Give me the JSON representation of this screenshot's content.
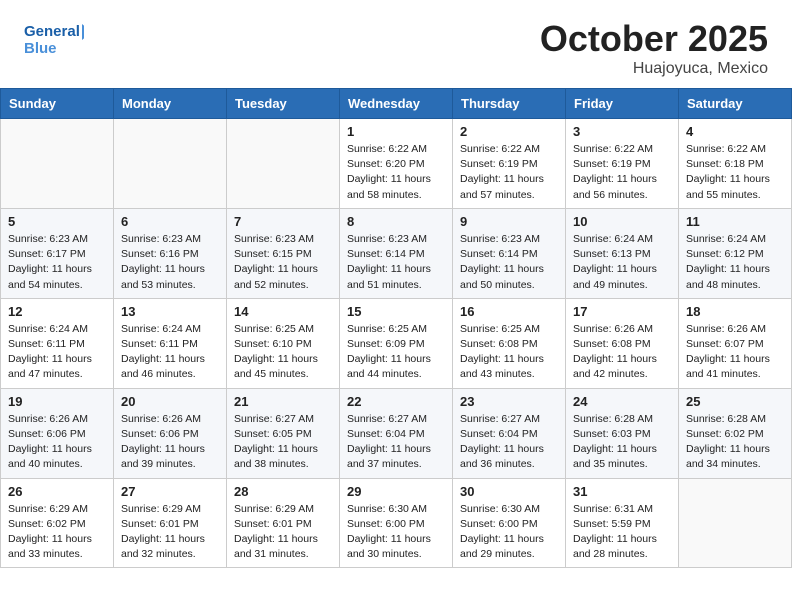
{
  "header": {
    "logo_text_general": "General",
    "logo_text_blue": "Blue",
    "month": "October 2025",
    "location": "Huajoyuca, Mexico"
  },
  "weekdays": [
    "Sunday",
    "Monday",
    "Tuesday",
    "Wednesday",
    "Thursday",
    "Friday",
    "Saturday"
  ],
  "weeks": [
    [
      {
        "day": "",
        "info": ""
      },
      {
        "day": "",
        "info": ""
      },
      {
        "day": "",
        "info": ""
      },
      {
        "day": "1",
        "info": "Sunrise: 6:22 AM\nSunset: 6:20 PM\nDaylight: 11 hours\nand 58 minutes."
      },
      {
        "day": "2",
        "info": "Sunrise: 6:22 AM\nSunset: 6:19 PM\nDaylight: 11 hours\nand 57 minutes."
      },
      {
        "day": "3",
        "info": "Sunrise: 6:22 AM\nSunset: 6:19 PM\nDaylight: 11 hours\nand 56 minutes."
      },
      {
        "day": "4",
        "info": "Sunrise: 6:22 AM\nSunset: 6:18 PM\nDaylight: 11 hours\nand 55 minutes."
      }
    ],
    [
      {
        "day": "5",
        "info": "Sunrise: 6:23 AM\nSunset: 6:17 PM\nDaylight: 11 hours\nand 54 minutes."
      },
      {
        "day": "6",
        "info": "Sunrise: 6:23 AM\nSunset: 6:16 PM\nDaylight: 11 hours\nand 53 minutes."
      },
      {
        "day": "7",
        "info": "Sunrise: 6:23 AM\nSunset: 6:15 PM\nDaylight: 11 hours\nand 52 minutes."
      },
      {
        "day": "8",
        "info": "Sunrise: 6:23 AM\nSunset: 6:14 PM\nDaylight: 11 hours\nand 51 minutes."
      },
      {
        "day": "9",
        "info": "Sunrise: 6:23 AM\nSunset: 6:14 PM\nDaylight: 11 hours\nand 50 minutes."
      },
      {
        "day": "10",
        "info": "Sunrise: 6:24 AM\nSunset: 6:13 PM\nDaylight: 11 hours\nand 49 minutes."
      },
      {
        "day": "11",
        "info": "Sunrise: 6:24 AM\nSunset: 6:12 PM\nDaylight: 11 hours\nand 48 minutes."
      }
    ],
    [
      {
        "day": "12",
        "info": "Sunrise: 6:24 AM\nSunset: 6:11 PM\nDaylight: 11 hours\nand 47 minutes."
      },
      {
        "day": "13",
        "info": "Sunrise: 6:24 AM\nSunset: 6:11 PM\nDaylight: 11 hours\nand 46 minutes."
      },
      {
        "day": "14",
        "info": "Sunrise: 6:25 AM\nSunset: 6:10 PM\nDaylight: 11 hours\nand 45 minutes."
      },
      {
        "day": "15",
        "info": "Sunrise: 6:25 AM\nSunset: 6:09 PM\nDaylight: 11 hours\nand 44 minutes."
      },
      {
        "day": "16",
        "info": "Sunrise: 6:25 AM\nSunset: 6:08 PM\nDaylight: 11 hours\nand 43 minutes."
      },
      {
        "day": "17",
        "info": "Sunrise: 6:26 AM\nSunset: 6:08 PM\nDaylight: 11 hours\nand 42 minutes."
      },
      {
        "day": "18",
        "info": "Sunrise: 6:26 AM\nSunset: 6:07 PM\nDaylight: 11 hours\nand 41 minutes."
      }
    ],
    [
      {
        "day": "19",
        "info": "Sunrise: 6:26 AM\nSunset: 6:06 PM\nDaylight: 11 hours\nand 40 minutes."
      },
      {
        "day": "20",
        "info": "Sunrise: 6:26 AM\nSunset: 6:06 PM\nDaylight: 11 hours\nand 39 minutes."
      },
      {
        "day": "21",
        "info": "Sunrise: 6:27 AM\nSunset: 6:05 PM\nDaylight: 11 hours\nand 38 minutes."
      },
      {
        "day": "22",
        "info": "Sunrise: 6:27 AM\nSunset: 6:04 PM\nDaylight: 11 hours\nand 37 minutes."
      },
      {
        "day": "23",
        "info": "Sunrise: 6:27 AM\nSunset: 6:04 PM\nDaylight: 11 hours\nand 36 minutes."
      },
      {
        "day": "24",
        "info": "Sunrise: 6:28 AM\nSunset: 6:03 PM\nDaylight: 11 hours\nand 35 minutes."
      },
      {
        "day": "25",
        "info": "Sunrise: 6:28 AM\nSunset: 6:02 PM\nDaylight: 11 hours\nand 34 minutes."
      }
    ],
    [
      {
        "day": "26",
        "info": "Sunrise: 6:29 AM\nSunset: 6:02 PM\nDaylight: 11 hours\nand 33 minutes."
      },
      {
        "day": "27",
        "info": "Sunrise: 6:29 AM\nSunset: 6:01 PM\nDaylight: 11 hours\nand 32 minutes."
      },
      {
        "day": "28",
        "info": "Sunrise: 6:29 AM\nSunset: 6:01 PM\nDaylight: 11 hours\nand 31 minutes."
      },
      {
        "day": "29",
        "info": "Sunrise: 6:30 AM\nSunset: 6:00 PM\nDaylight: 11 hours\nand 30 minutes."
      },
      {
        "day": "30",
        "info": "Sunrise: 6:30 AM\nSunset: 6:00 PM\nDaylight: 11 hours\nand 29 minutes."
      },
      {
        "day": "31",
        "info": "Sunrise: 6:31 AM\nSunset: 5:59 PM\nDaylight: 11 hours\nand 28 minutes."
      },
      {
        "day": "",
        "info": ""
      }
    ]
  ]
}
